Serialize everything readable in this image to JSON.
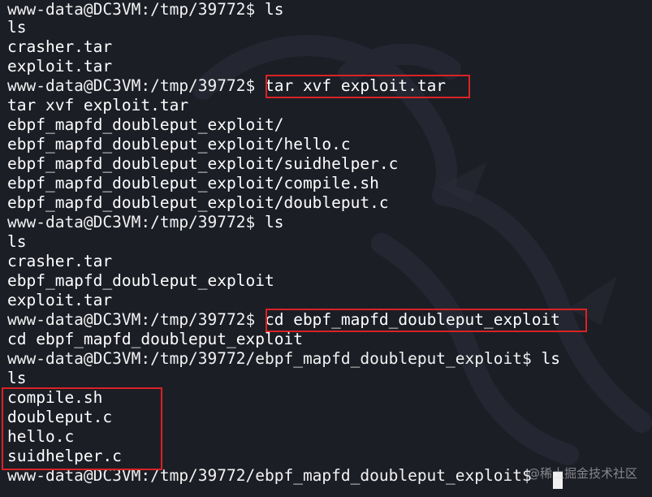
{
  "terminal": {
    "lines": [
      {
        "prompt": "www-data@DC3VM:/tmp/39772$ ",
        "command": "ls"
      },
      {
        "text": "ls"
      },
      {
        "text": "crasher.tar"
      },
      {
        "text": "exploit.tar"
      },
      {
        "prompt": "www-data@DC3VM:/tmp/39772$ ",
        "command": "tar xvf exploit.tar"
      },
      {
        "text": "tar xvf exploit.tar"
      },
      {
        "text": "ebpf_mapfd_doubleput_exploit/"
      },
      {
        "text": "ebpf_mapfd_doubleput_exploit/hello.c"
      },
      {
        "text": "ebpf_mapfd_doubleput_exploit/suidhelper.c"
      },
      {
        "text": "ebpf_mapfd_doubleput_exploit/compile.sh"
      },
      {
        "text": "ebpf_mapfd_doubleput_exploit/doubleput.c"
      },
      {
        "prompt": "www-data@DC3VM:/tmp/39772$ ",
        "command": "ls"
      },
      {
        "text": "ls"
      },
      {
        "text": "crasher.tar"
      },
      {
        "text": "ebpf_mapfd_doubleput_exploit"
      },
      {
        "text": "exploit.tar"
      },
      {
        "prompt": "www-data@DC3VM:/tmp/39772$ ",
        "command": "cd ebpf_mapfd_doubleput_exploit"
      },
      {
        "text": "cd ebpf_mapfd_doubleput_exploit"
      },
      {
        "prompt": "www-data@DC3VM:/tmp/39772/ebpf_mapfd_doubleput_exploit$ ",
        "command": "ls"
      },
      {
        "text": "ls"
      },
      {
        "text": "compile.sh"
      },
      {
        "text": "doubleput.c"
      },
      {
        "text": "hello.c"
      },
      {
        "text": "suidhelper.c"
      },
      {
        "prompt": "www-data@DC3VM:/tmp/39772/ebpf_mapfd_doubleput_exploit$ ",
        "command": ""
      }
    ]
  },
  "watermark": {
    "text": "@稀土掘金技术社区"
  },
  "colors": {
    "background": "#1c1e26",
    "text": "#ffffff",
    "highlight_box": "#d82323"
  }
}
